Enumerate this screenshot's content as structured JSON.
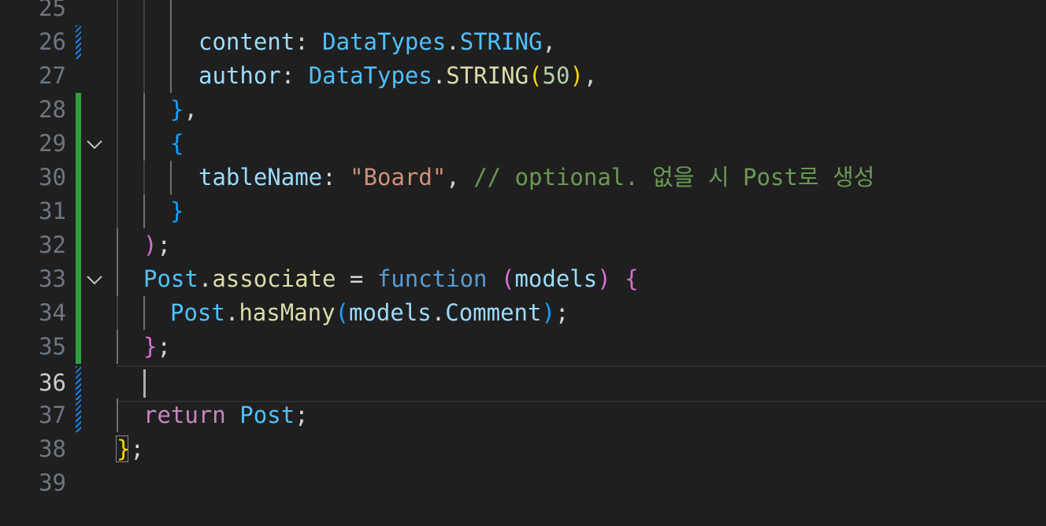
{
  "editor": {
    "active_line": "36",
    "lines": [
      {
        "number": "25"
      },
      {
        "number": "26",
        "t": [
          "content",
          ": ",
          "DataTypes",
          ".",
          "STRING",
          ","
        ]
      },
      {
        "number": "27",
        "t": [
          "author",
          ": ",
          "DataTypes",
          ".",
          "STRING",
          "(",
          "50",
          ")",
          ","
        ]
      },
      {
        "number": "28",
        "t": [
          "}",
          ","
        ]
      },
      {
        "number": "29",
        "t": [
          "{"
        ]
      },
      {
        "number": "30",
        "t": [
          "tableName",
          ": ",
          "\"Board\"",
          ", ",
          "// optional. 없을 시 Post로 생성"
        ]
      },
      {
        "number": "31",
        "t": [
          "}"
        ]
      },
      {
        "number": "32",
        "t": [
          ")",
          ";"
        ]
      },
      {
        "number": "33",
        "t": [
          "Post",
          ".",
          "associate",
          " = ",
          "function",
          " ",
          "(",
          "models",
          ")",
          " ",
          "{"
        ]
      },
      {
        "number": "34",
        "t": [
          "Post",
          ".",
          "hasMany",
          "(",
          "models",
          ".",
          "Comment",
          ")",
          ";"
        ]
      },
      {
        "number": "35",
        "t": [
          "}",
          ";"
        ]
      },
      {
        "number": "36",
        "t": []
      },
      {
        "number": "37",
        "t": [
          "return",
          " ",
          "Post",
          ";"
        ]
      },
      {
        "number": "38",
        "t": [
          "}",
          ";"
        ]
      },
      {
        "number": "39"
      }
    ]
  },
  "colors": {
    "background": "#1f1f1f",
    "added_gutter": "#2ea043",
    "modified_gutter": "#1b81e8",
    "bracket_gold": "#ffd700",
    "bracket_orchid": "#da70d6",
    "bracket_blue": "#179fff"
  },
  "icons": [
    "fold-chevron-icon",
    "fold-chevron-icon"
  ]
}
